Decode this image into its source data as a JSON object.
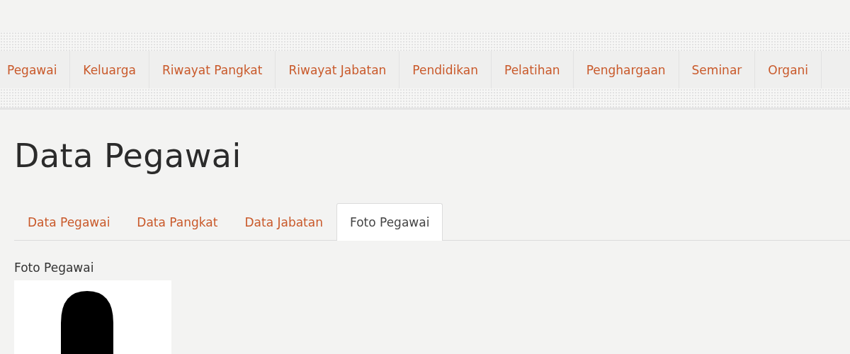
{
  "main_nav": [
    {
      "label": "Pegawai"
    },
    {
      "label": "Keluarga"
    },
    {
      "label": "Riwayat Pangkat"
    },
    {
      "label": "Riwayat Jabatan"
    },
    {
      "label": "Pendidikan"
    },
    {
      "label": "Pelatihan"
    },
    {
      "label": "Penghargaan"
    },
    {
      "label": "Seminar"
    },
    {
      "label": "Organi"
    }
  ],
  "heading": "Data Pegawai",
  "tabs": [
    {
      "label": "Data Pegawai",
      "selected": false
    },
    {
      "label": "Data Pangkat",
      "selected": false
    },
    {
      "label": "Data Jabatan",
      "selected": false
    },
    {
      "label": "Foto Pegawai",
      "selected": true
    }
  ],
  "photo_section": {
    "label": "Foto Pegawai"
  }
}
